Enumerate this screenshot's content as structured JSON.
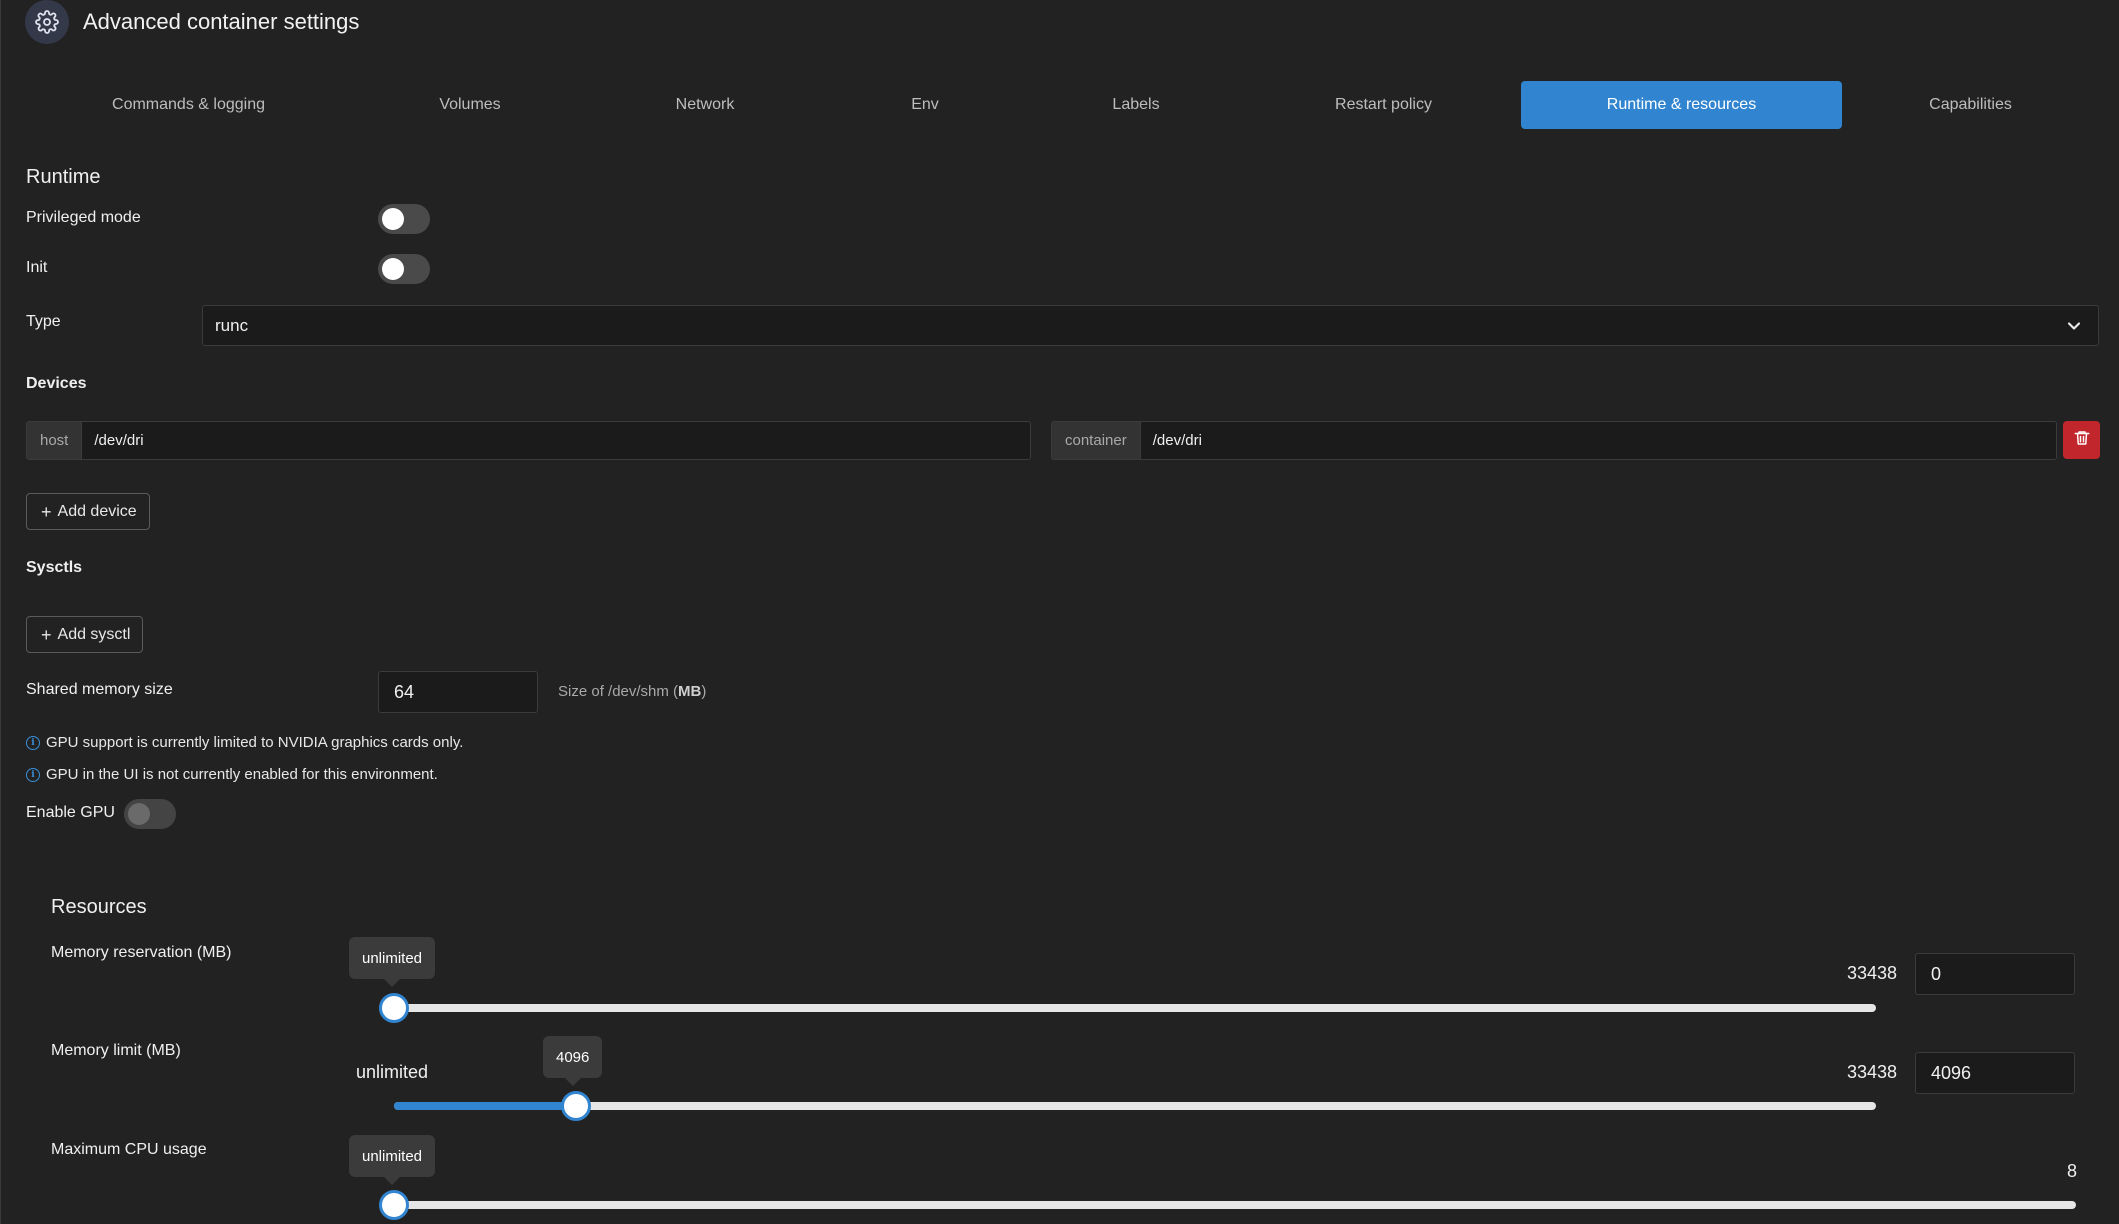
{
  "header": {
    "title": "Advanced container settings",
    "icon": "gear-icon"
  },
  "tabs": [
    {
      "label": "Commands & logging",
      "active": false
    },
    {
      "label": "Volumes",
      "active": false
    },
    {
      "label": "Network",
      "active": false
    },
    {
      "label": "Env",
      "active": false
    },
    {
      "label": "Labels",
      "active": false
    },
    {
      "label": "Restart policy",
      "active": false
    },
    {
      "label": "Runtime & resources",
      "active": true
    },
    {
      "label": "Capabilities",
      "active": false
    }
  ],
  "runtime": {
    "title": "Runtime",
    "privileged_label": "Privileged mode",
    "privileged_on": false,
    "init_label": "Init",
    "init_on": false,
    "type_label": "Type",
    "type_value": "runc"
  },
  "devices": {
    "title": "Devices",
    "host_addon": "host",
    "host_value": "/dev/dri",
    "container_addon": "container",
    "container_value": "/dev/dri",
    "add_label": "Add device"
  },
  "sysctls": {
    "title": "Sysctls",
    "add_label": "Add sysctl"
  },
  "shm": {
    "label": "Shared memory size",
    "value": "64",
    "hint_prefix": "Size of /dev/shm (",
    "hint_unit": "MB",
    "hint_suffix": ")"
  },
  "gpu": {
    "info1": "GPU support is currently limited to NVIDIA graphics cards only.",
    "info2": "GPU in the UI is not currently enabled for this environment.",
    "enable_label": "Enable GPU",
    "enabled": false
  },
  "resources": {
    "title": "Resources",
    "memory_reservation": {
      "label": "Memory reservation (MB)",
      "tooltip": "unlimited",
      "max": "33438",
      "value": "0",
      "fraction": 0
    },
    "memory_limit": {
      "label": "Memory limit (MB)",
      "min_label": "unlimited",
      "tooltip": "4096",
      "max": "33438",
      "value": "4096",
      "fraction": 0.1225
    },
    "cpu": {
      "label": "Maximum CPU usage",
      "tooltip": "unlimited",
      "max": "8",
      "fraction": 0
    }
  },
  "colors": {
    "accent": "#3185d0",
    "danger": "#c0262b",
    "background": "#222222"
  }
}
